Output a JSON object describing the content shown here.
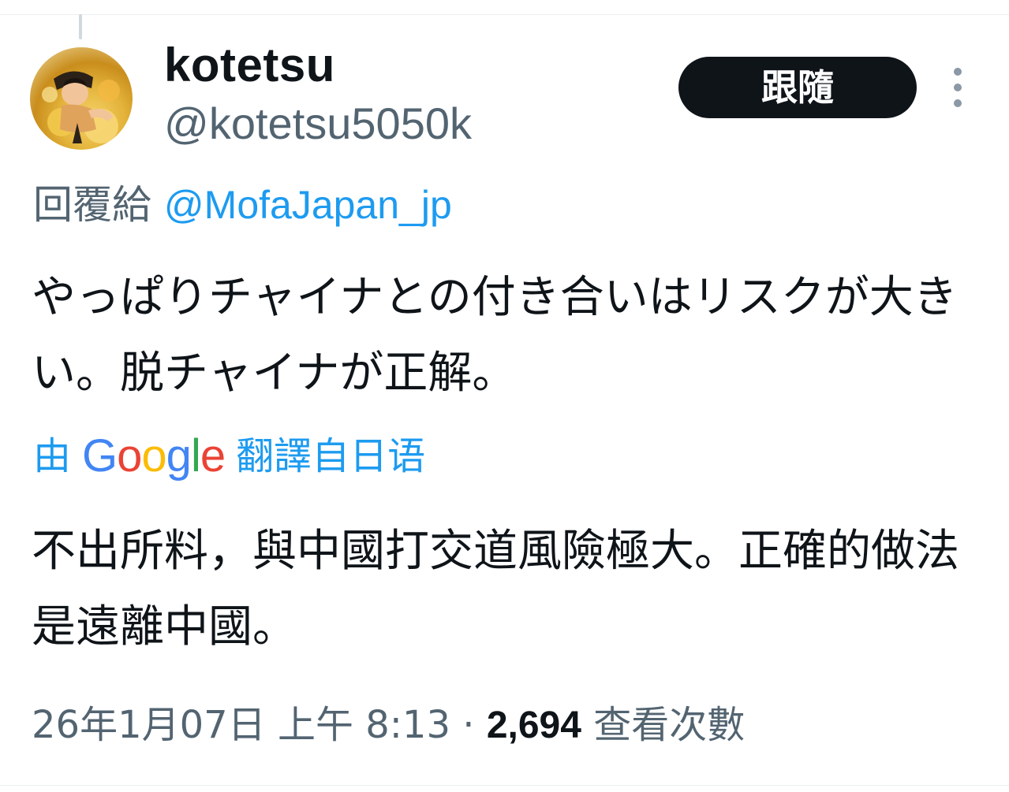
{
  "tweet": {
    "author": {
      "name": "kotetsu",
      "handle": "@kotetsu5050k"
    },
    "follow_label": "跟隨",
    "more_icon": "more-vertical-icon",
    "reply": {
      "prefix": "回覆給",
      "mention": "@MofaJapan_jp"
    },
    "text": "やっぱりチャイナとの付き合いはリスクが大きい。脱チャイナが正解。",
    "translation": {
      "prefix": "由",
      "provider": "Google",
      "suffix": "翻譯自日语",
      "text": "不出所料，與中國打交道風險極大。正確的做法是遠離中國。"
    },
    "meta": {
      "timestamp": "26年1月07日 上午 8:13",
      "separator": "·",
      "views_count": "2,694",
      "views_label": "查看次數"
    }
  },
  "colors": {
    "text_primary": "#0f1419",
    "text_secondary": "#536471",
    "link": "#1d9bf0",
    "follow_bg": "#0f1419",
    "google_blue": "#4285f4",
    "google_red": "#ea4335",
    "google_yellow": "#fbbc05",
    "google_green": "#34a853"
  }
}
